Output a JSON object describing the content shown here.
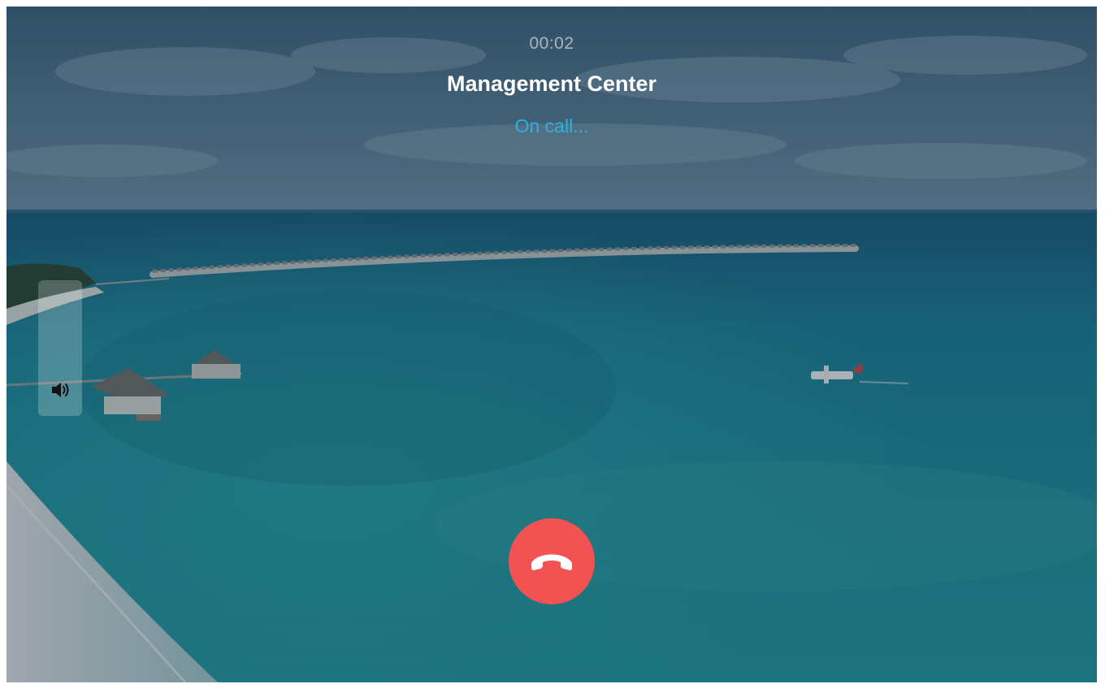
{
  "call": {
    "timer": "00:02",
    "caller_name": "Management Center",
    "status": "On call..."
  },
  "controls": {
    "volume_icon": "speaker-volume-icon",
    "hangup_icon": "phone-hangup-icon"
  },
  "colors": {
    "hangup_button": "#f25252",
    "status_text": "#2bb3e0",
    "caller_name_text": "#ffffff",
    "timer_text": "#a9b6bf"
  }
}
